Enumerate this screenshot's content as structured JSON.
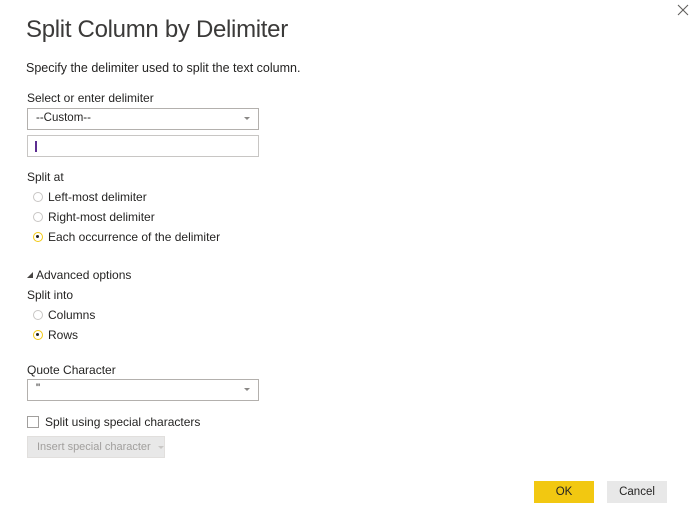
{
  "dialog": {
    "title": "Split Column by Delimiter",
    "description": "Specify the delimiter used to split the text column.",
    "close_icon": "close-icon"
  },
  "delimiter": {
    "label": "Select or enter delimiter",
    "selected": "--Custom--",
    "custom_value": ""
  },
  "split_at": {
    "label": "Split at",
    "options": [
      {
        "label": "Left-most delimiter",
        "checked": false
      },
      {
        "label": "Right-most delimiter",
        "checked": false
      },
      {
        "label": "Each occurrence of the delimiter",
        "checked": true
      }
    ]
  },
  "advanced": {
    "toggle_label": "Advanced options",
    "expanded": true,
    "split_into": {
      "label": "Split into",
      "options": [
        {
          "label": "Columns",
          "checked": false
        },
        {
          "label": "Rows",
          "checked": true
        }
      ]
    },
    "quote_character": {
      "label": "Quote Character",
      "selected": "\""
    },
    "special_chars": {
      "label": "Split using special characters",
      "checked": false,
      "insert_button_label": "Insert special character",
      "insert_button_enabled": false
    }
  },
  "buttons": {
    "ok_label": "OK",
    "cancel_label": "Cancel"
  },
  "colors": {
    "accent": "#f2c811",
    "button_secondary": "#e8e8e8",
    "disabled_text": "#a19f9d"
  }
}
